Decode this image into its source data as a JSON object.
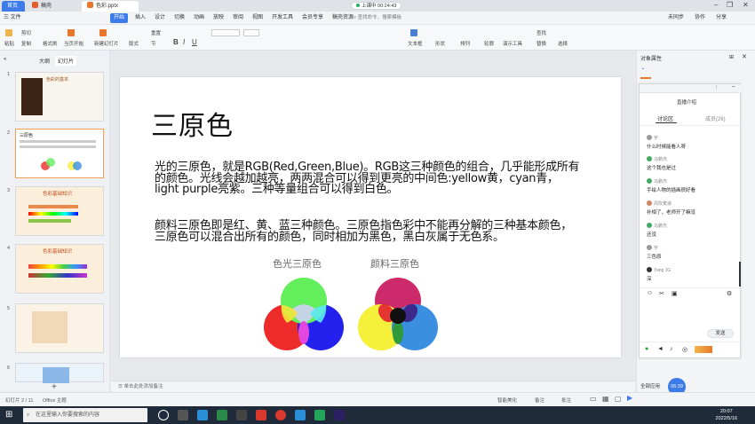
{
  "tabs": {
    "home": "首页",
    "doc1": "稿壳",
    "doc2": "色彩.pptx"
  },
  "live_badge": "上课中 00:24:43",
  "menu": [
    "三 文件",
    "开始",
    "插入",
    "设计",
    "切换",
    "动画",
    "放映",
    "审阅",
    "视图",
    "开发工具",
    "会员专享",
    "稿壳资源"
  ],
  "menu_right": [
    "未同步",
    "协作",
    "分享"
  ],
  "search_placeholder": "查找命令、搜索模板",
  "ribbon": {
    "paste": "粘贴",
    "cut": "剪切",
    "copy": "复制",
    "format_painter": "格式刷",
    "play": "当页开始",
    "new_slide": "新建幻灯片",
    "layout": "版式",
    "section": "节",
    "reset": "重置",
    "text_box": "文本框",
    "shape": "形状",
    "arrange": "排列",
    "outline": "轮廓",
    "slideshow": "演示工具",
    "replace": "替换",
    "select": "选择",
    "find": "查找"
  },
  "panel_tabs": {
    "outline": "大纲",
    "slides": "幻灯片"
  },
  "thumbs": [
    {
      "num": "1",
      "title": "色彩的基本"
    },
    {
      "num": "2",
      "title": "三原色"
    },
    {
      "num": "3",
      "title": "色彩基础知识"
    },
    {
      "num": "4",
      "title": "色彩基础知识"
    },
    {
      "num": "5",
      "title": ""
    },
    {
      "num": "6",
      "title": ""
    }
  ],
  "slide": {
    "title": "三原色",
    "para1": "光的三原色，就是RGB(Red,Green,Blue)。RGB这三种颜色的组合，几乎能形成所有的颜色。光线会越加越亮，两两混合可以得到更亮的中间色:yellow黄，cyan青，light purple亮紫。三种等量组合可以得到白色。",
    "para2": "颜料三原色即是红、黄、蓝三种颜色。三原色指色彩中不能再分解的三种基本颜色，三原色可以混合出所有的颜色，同时相加为黑色，黑白灰属于无色系。",
    "caption_light": "色光三原色",
    "caption_pigment": "颜料三原色"
  },
  "notes_placeholder": "单击此处添加备注",
  "right_panel": {
    "title": "对象属性",
    "chat_title": "直播介绍",
    "chat_tabs": {
      "discussion": "讨论区",
      "members": "成员(26)"
    },
    "messages": [
      {
        "name": "宇",
        "text": "什么时候能看人呀"
      },
      {
        "name": "马鹏杰",
        "text": "这个我也是过"
      },
      {
        "name": "马鹏杰",
        "text": "手绘人物的插画很好看"
      },
      {
        "name": "风吹麦浪",
        "text": "补相了，老师开了嘛没"
      },
      {
        "name": "马鹏杰",
        "text": "还没"
      },
      {
        "name": "宇",
        "text": "三色原"
      },
      {
        "name": "Yang JG",
        "text": "深"
      }
    ],
    "send": "发送",
    "all_apps": "全部应用",
    "timer": "06:39"
  },
  "status": {
    "slide_count": "幻灯片 2 / 11",
    "theme": "Office 主题",
    "smart_beautify": "智能美化",
    "notes": "备注",
    "comments": "批注",
    "zoom": "75%"
  },
  "taskbar": {
    "search_placeholder": "在这里输入你要搜索的内容",
    "time": "20:07",
    "date": "2022/5/16"
  },
  "colors": {
    "accent": "#3c7be8",
    "rgb_red": "#ee2b2b",
    "rgb_green": "#63ee5c",
    "rgb_blue": "#2420ee",
    "cmy_magenta": "#cc2a6a",
    "cmy_yellow": "#f5f03a",
    "cmy_cyan": "#3a8fe0"
  }
}
